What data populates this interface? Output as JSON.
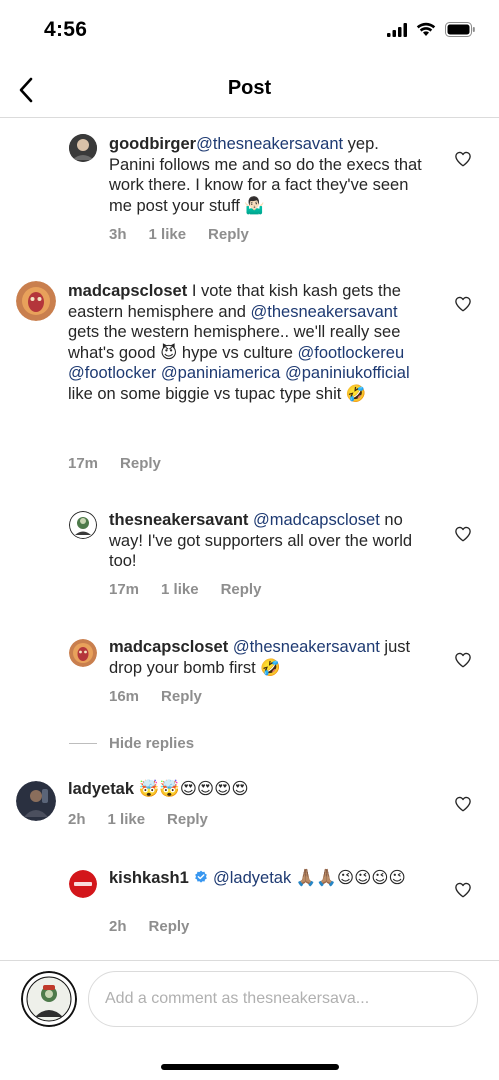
{
  "status": {
    "time": "4:56"
  },
  "header": {
    "title": "Post"
  },
  "comments": [
    {
      "username": "goodbirger",
      "mention": "@thesneakersavant",
      "text": " yep. Panini follows me and so do the execs that work there. I know for a fact they've seen me post your stuff 🤷🏻‍♂️",
      "time": "3h",
      "likes": "1 like",
      "reply": "Reply"
    },
    {
      "username": "madcapscloset",
      "text_a": " I vote that kish kash gets the eastern hemisphere and ",
      "mention_a": "@thesneakersavant",
      "text_b": " gets the western hemisphere.. we'll really see what's good 😈 hype vs culture ",
      "mention_b": "@footlockereu",
      "mention_c": "@footlocker",
      "mention_d": "@paniniamerica",
      "mention_e": "@paniniukofficial",
      "text_c": " like on some biggie vs tupac type shit 🤣",
      "time": "17m",
      "reply": "Reply"
    },
    {
      "username": "thesneakersavant",
      "mention": "@madcapscloset",
      "text": " no way! I've got supporters all over the world too!",
      "time": "17m",
      "likes": "1 like",
      "reply": "Reply"
    },
    {
      "username": "madcapscloset",
      "mention": "@thesneakersavant",
      "text": " just drop your bomb first 🤣",
      "time": "16m",
      "reply": "Reply"
    },
    {
      "username": "ladyetak",
      "text": " 🤯🤯😍😍😍😍",
      "time": "2h",
      "likes": "1 like",
      "reply": "Reply"
    },
    {
      "username": "kishkash1",
      "mention": "@ladyetak",
      "text": " 🙏🏽🙏🏽😉😉😉😉",
      "time": "2h",
      "reply": "Reply"
    }
  ],
  "hide_replies": "Hide replies",
  "composer": {
    "placeholder": "Add a comment as thesneakersava..."
  },
  "icons": {
    "back": "chevron-left-icon",
    "heart": "heart-outline-icon",
    "verified": "verified-badge-icon",
    "signal": "signal-icon",
    "wifi": "wifi-icon",
    "battery": "battery-icon"
  },
  "colors": {
    "mention": "#1e3a72",
    "meta": "#8e8e8e",
    "verified": "#3897f0"
  }
}
